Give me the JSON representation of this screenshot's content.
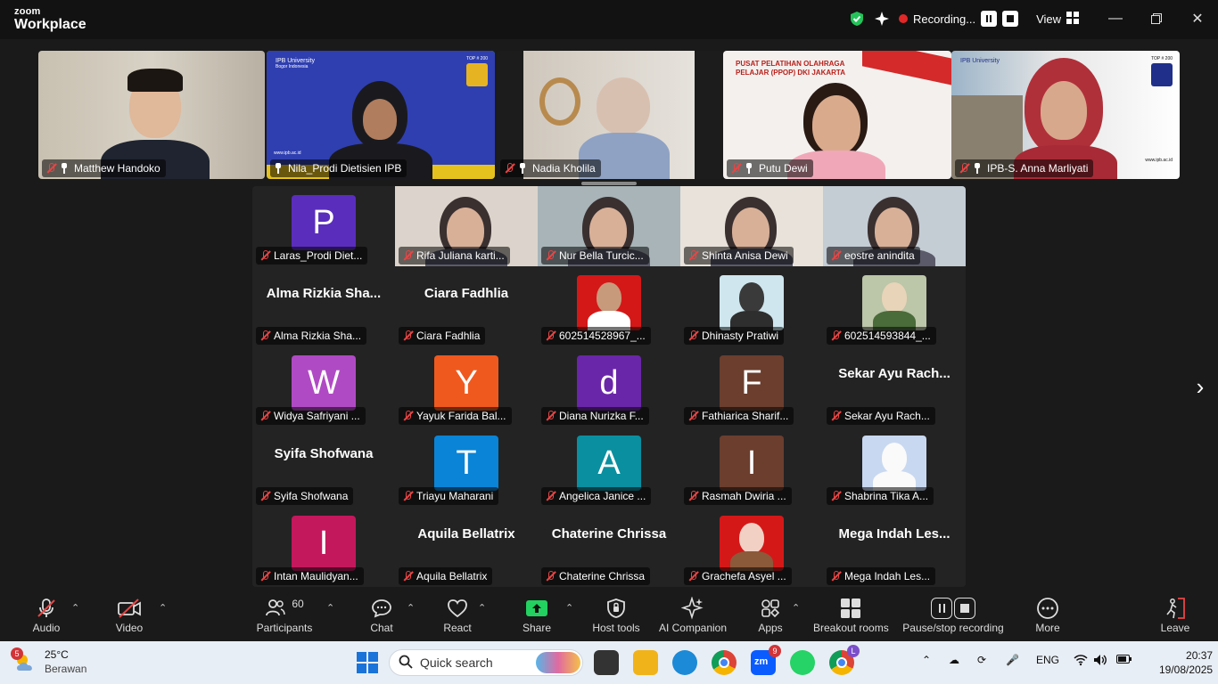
{
  "app": {
    "brand_top": "zoom",
    "brand_bottom": "Workplace"
  },
  "titlebar": {
    "recording_label": "Recording...",
    "view_label": "View"
  },
  "top_strip": [
    {
      "name": "Matthew Handoko",
      "muted": true,
      "pinned": true
    },
    {
      "name": "Nila_Prodi Dietisien IPB",
      "muted": false,
      "pinned": true,
      "active": true
    },
    {
      "name": "Nadia Kholila",
      "muted": true,
      "pinned": true
    },
    {
      "name": "Putu Dewi",
      "muted": true,
      "pinned": true
    },
    {
      "name": "IPB-S. Anna Marliyati",
      "muted": true,
      "pinned": true
    }
  ],
  "background_text": {
    "ipb_university": "IPB University",
    "ipb_subtitle": "Bogor Indonesia",
    "top_rank": "TOP # 200",
    "site_url": "www.ipb.ac.id",
    "ppop_banner": "PUSAT PELATIHAN OLAHRAGA PELAJAR (PPOP) DKI JAKARTA"
  },
  "gallery": [
    {
      "name": "Laras_Prodi Diet...",
      "avatar": "P",
      "color": "#5a2dbd"
    },
    {
      "name": "Rifa Juliana karti...",
      "video": true
    },
    {
      "name": "Nur Bella Turcic...",
      "video": true
    },
    {
      "name": "Shinta Anisa Dewi",
      "video": true
    },
    {
      "name": "eostre anindita",
      "video": true
    },
    {
      "name": "Alma Rizkia Sha...",
      "big_name": "Alma Rizkia Sha..."
    },
    {
      "name": "Ciara Fadhlia",
      "big_name": "Ciara Fadhlia"
    },
    {
      "name": "602514528967_...",
      "photo": "red"
    },
    {
      "name": "Dhinasty Pratiwi",
      "photo": "light"
    },
    {
      "name": "602514593844_...",
      "photo": "plant"
    },
    {
      "name": "Widya Safriyani ...",
      "avatar": "W",
      "color": "#b04ac4"
    },
    {
      "name": "Yayuk Farida Bal...",
      "avatar": "Y",
      "color": "#f0591e"
    },
    {
      "name": "Diana Nurizka F...",
      "avatar": "d",
      "color": "#6a26a8"
    },
    {
      "name": "Fathiarica Sharif...",
      "avatar": "F",
      "color": "#6b3e2e"
    },
    {
      "name": "Sekar Ayu Rach...",
      "big_name": "Sekar Ayu Rach..."
    },
    {
      "name": "Syifa Shofwana",
      "big_name": "Syifa Shofwana"
    },
    {
      "name": "Triayu Maharani",
      "avatar": "T",
      "color": "#0a84d6"
    },
    {
      "name": "Angelica Janice ...",
      "avatar": "A",
      "color": "#0a8fa0"
    },
    {
      "name": "Rasmah Dwiria ...",
      "avatar": "I",
      "color": "#6b3e2e"
    },
    {
      "name": "Shabrina Tika A...",
      "photo": "hijab-blue"
    },
    {
      "name": "Intan Maulidyan...",
      "avatar": "I",
      "color": "#c4185c"
    },
    {
      "name": "Aquila Bellatrix",
      "big_name": "Aquila Bellatrix"
    },
    {
      "name": "Chaterine Chrissa",
      "big_name": "Chaterine Chrissa"
    },
    {
      "name": "Grachefa Asyel ...",
      "photo": "red-hijab"
    },
    {
      "name": "Mega Indah Les...",
      "big_name": "Mega Indah Les..."
    }
  ],
  "toolbar": {
    "audio": "Audio",
    "video": "Video",
    "participants": "Participants",
    "participants_count": "60",
    "chat": "Chat",
    "react": "React",
    "share": "Share",
    "host_tools": "Host tools",
    "ai_companion": "AI Companion",
    "apps": "Apps",
    "breakout_rooms": "Breakout rooms",
    "pause_stop_recording": "Pause/stop recording",
    "more": "More",
    "leave": "Leave"
  },
  "taskbar": {
    "weather_badge": "5",
    "temperature": "25°C",
    "condition": "Berawan",
    "search_placeholder": "Quick search",
    "zoom_badge": "9",
    "chrome_profile": "L",
    "language": "ENG",
    "time": "20:37",
    "date": "19/08/2025"
  },
  "colors": {
    "active_speaker": "#2bd970",
    "muted": "#e84545",
    "share_green": "#23d160"
  }
}
